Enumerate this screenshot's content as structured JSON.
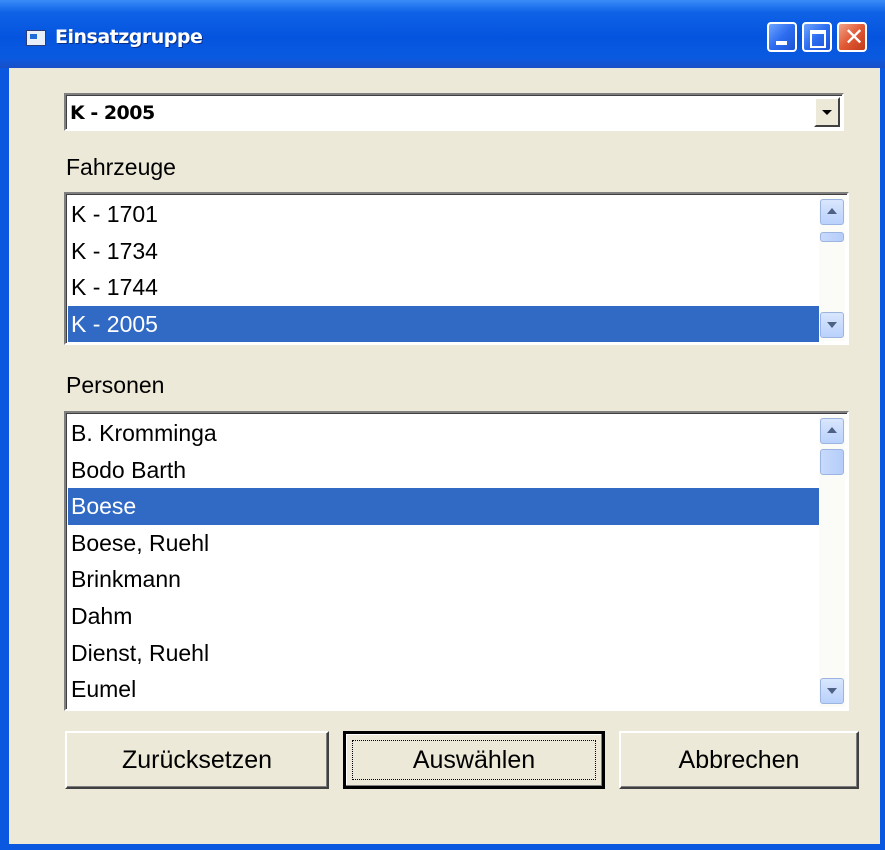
{
  "window": {
    "title": "Einsatzgruppe",
    "icon": "form-icon"
  },
  "combo": {
    "value": "K - 2005"
  },
  "fahrzeuge": {
    "label": "Fahrzeuge",
    "items": [
      "K - 1701",
      "K - 1734",
      "K - 1744",
      "K - 2005"
    ],
    "selected_index": 3
  },
  "personen": {
    "label": "Personen",
    "items": [
      "B. Kromminga",
      "Bodo Barth",
      "Boese",
      "Boese, Ruehl",
      "Brinkmann",
      "Dahm",
      "Dienst, Ruehl",
      "Eumel"
    ],
    "selected_index": 2
  },
  "buttons": {
    "reset": "Zurücksetzen",
    "select": "Auswählen",
    "cancel": "Abbrechen"
  },
  "colors": {
    "selection": "#316ac5",
    "dialog_bg": "#ece9d8",
    "titlebar": "#0554df"
  }
}
